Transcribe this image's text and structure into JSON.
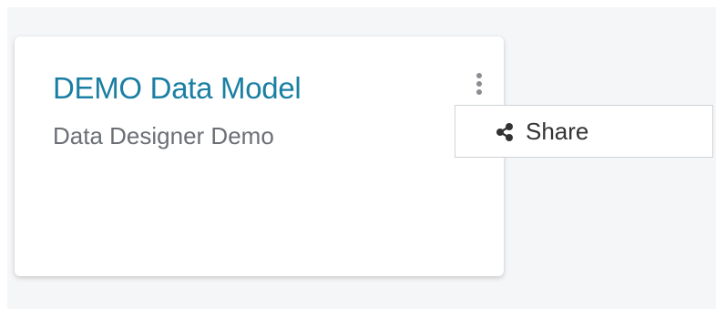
{
  "card": {
    "title": "DEMO Data Model",
    "subtitle": "Data Designer Demo",
    "menu_icon": "kebab-vertical-icon"
  },
  "menu": {
    "items": [
      {
        "label": "Share",
        "icon": "share-icon"
      }
    ]
  },
  "colors": {
    "title": "#1a7fa3",
    "subtitle": "#6b6f75",
    "background": "#f5f6f8",
    "card": "#ffffff",
    "kebab": "#8a8e93"
  }
}
